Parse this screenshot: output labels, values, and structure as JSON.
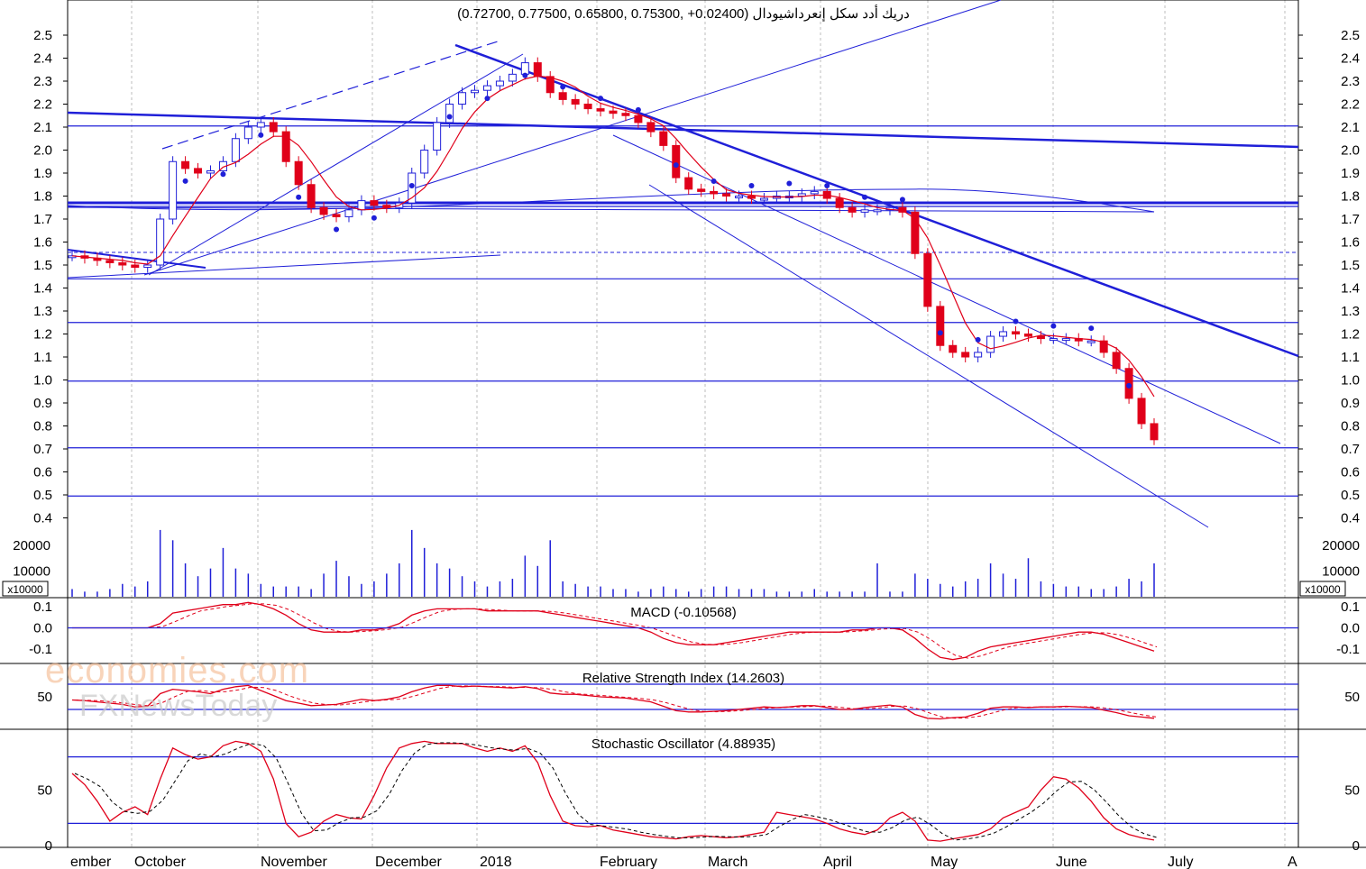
{
  "chart_data": {
    "type": "candlestick",
    "title": "(0.72700, 0.77500, 0.65800, 0.75300, +0.02400) دريك أدد سكل إنعرداشيودال",
    "x_labels": [
      "ember",
      "October",
      "November",
      "December",
      "2018",
      "February",
      "March",
      "April",
      "May",
      "June",
      "July",
      "A"
    ],
    "price_axis": {
      "ticks": [
        "0.4",
        "0.5",
        "0.6",
        "0.7",
        "0.8",
        "0.9",
        "1.0",
        "1.1",
        "1.2",
        "1.3",
        "1.4",
        "1.5",
        "1.6",
        "1.7",
        "1.8",
        "1.9",
        "2.0",
        "2.1",
        "2.2",
        "2.3",
        "2.4",
        "2.5"
      ],
      "ylim": [
        0.4,
        2.5
      ]
    },
    "price_series": [
      1.54,
      1.53,
      1.52,
      1.51,
      1.5,
      1.49,
      1.5,
      1.7,
      1.95,
      1.92,
      1.9,
      1.91,
      1.95,
      2.05,
      2.1,
      2.12,
      2.08,
      1.95,
      1.85,
      1.75,
      1.72,
      1.71,
      1.74,
      1.78,
      1.76,
      1.75,
      1.77,
      1.9,
      2.0,
      2.12,
      2.2,
      2.25,
      2.26,
      2.28,
      2.3,
      2.33,
      2.38,
      2.32,
      2.25,
      2.22,
      2.2,
      2.18,
      2.17,
      2.16,
      2.15,
      2.12,
      2.08,
      2.02,
      1.88,
      1.83,
      1.82,
      1.81,
      1.8,
      1.8,
      1.79,
      1.79,
      1.8,
      1.8,
      1.81,
      1.82,
      1.79,
      1.75,
      1.73,
      1.74,
      1.74,
      1.75,
      1.73,
      1.55,
      1.32,
      1.15,
      1.12,
      1.1,
      1.12,
      1.19,
      1.21,
      1.2,
      1.19,
      1.18,
      1.18,
      1.18,
      1.17,
      1.17,
      1.12,
      1.05,
      0.92,
      0.81,
      0.74
    ],
    "volume_axis": {
      "ticks": [
        "10000",
        "20000"
      ],
      "unit": "x10000"
    },
    "volume_series": [
      0.3,
      0.2,
      0.2,
      0.3,
      0.5,
      0.4,
      0.6,
      2.6,
      2.2,
      1.3,
      0.8,
      1.1,
      1.9,
      1.1,
      0.9,
      0.5,
      0.4,
      0.4,
      0.4,
      0.3,
      0.9,
      1.4,
      0.8,
      0.5,
      0.6,
      0.9,
      1.3,
      2.6,
      1.9,
      1.3,
      1.1,
      0.8,
      0.6,
      0.4,
      0.6,
      0.7,
      1.6,
      1.2,
      2.2,
      0.6,
      0.5,
      0.4,
      0.4,
      0.3,
      0.3,
      0.2,
      0.3,
      0.4,
      0.3,
      0.2,
      0.3,
      0.4,
      0.4,
      0.3,
      0.3,
      0.3,
      0.2,
      0.2,
      0.2,
      0.3,
      0.2,
      0.2,
      0.2,
      0.2,
      1.3,
      0.2,
      0.2,
      0.9,
      0.7,
      0.5,
      0.4,
      0.6,
      0.7,
      1.3,
      0.9,
      0.7,
      1.5,
      0.6,
      0.5,
      0.4,
      0.4,
      0.3,
      0.3,
      0.4,
      0.7,
      0.6,
      1.3
    ],
    "macd": {
      "label": "MACD (-0.10568)",
      "ticks": [
        "-0.1",
        "0.0",
        "0.1"
      ],
      "ylim": [
        -0.16,
        0.13
      ],
      "values": [
        0.0,
        0.0,
        0.0,
        0.0,
        0.0,
        0.0,
        0.0,
        0.02,
        0.07,
        0.08,
        0.09,
        0.1,
        0.11,
        0.11,
        0.12,
        0.11,
        0.09,
        0.06,
        0.02,
        -0.01,
        -0.02,
        -0.02,
        -0.02,
        -0.01,
        -0.01,
        0.0,
        0.02,
        0.06,
        0.08,
        0.09,
        0.09,
        0.09,
        0.09,
        0.08,
        0.08,
        0.08,
        0.08,
        0.08,
        0.07,
        0.06,
        0.05,
        0.04,
        0.03,
        0.02,
        0.01,
        0.0,
        -0.02,
        -0.05,
        -0.07,
        -0.08,
        -0.08,
        -0.08,
        -0.07,
        -0.06,
        -0.05,
        -0.04,
        -0.03,
        -0.02,
        -0.02,
        -0.02,
        -0.02,
        -0.02,
        -0.01,
        -0.01,
        0.0,
        0.0,
        -0.01,
        -0.05,
        -0.1,
        -0.14,
        -0.15,
        -0.14,
        -0.11,
        -0.09,
        -0.08,
        -0.07,
        -0.06,
        -0.05,
        -0.04,
        -0.03,
        -0.02,
        -0.02,
        -0.03,
        -0.05,
        -0.07,
        -0.09,
        -0.11
      ]
    },
    "rsi": {
      "label": "Relative Strength Index (14.2603)",
      "ticks": [
        "50"
      ],
      "ylim": [
        0,
        100
      ],
      "levels": [
        70,
        30
      ],
      "values": [
        45,
        44,
        42,
        40,
        38,
        34,
        35,
        55,
        62,
        60,
        58,
        55,
        62,
        66,
        68,
        60,
        52,
        44,
        40,
        36,
        37,
        38,
        42,
        46,
        44,
        46,
        50,
        58,
        64,
        68,
        68,
        66,
        67,
        66,
        65,
        64,
        66,
        63,
        56,
        54,
        54,
        52,
        50,
        49,
        48,
        45,
        42,
        35,
        28,
        26,
        26,
        27,
        28,
        30,
        32,
        34,
        33,
        34,
        36,
        36,
        33,
        30,
        30,
        33,
        35,
        37,
        34,
        22,
        16,
        15,
        17,
        18,
        24,
        32,
        34,
        34,
        33,
        34,
        34,
        35,
        34,
        33,
        29,
        25,
        20,
        18,
        16
      ]
    },
    "stochastic": {
      "label": "Stochastic Oscillator (4.88935)",
      "ticks": [
        "0",
        "50"
      ],
      "ylim": [
        0,
        100
      ],
      "levels": [
        80,
        20
      ],
      "values": [
        65,
        55,
        40,
        22,
        30,
        35,
        28,
        60,
        88,
        82,
        78,
        80,
        90,
        94,
        92,
        85,
        60,
        20,
        8,
        12,
        22,
        28,
        25,
        24,
        45,
        70,
        88,
        92,
        94,
        92,
        92,
        92,
        88,
        85,
        88,
        85,
        90,
        75,
        45,
        22,
        18,
        17,
        18,
        14,
        12,
        10,
        8,
        7,
        6,
        8,
        9,
        8,
        7,
        8,
        10,
        12,
        30,
        28,
        26,
        24,
        20,
        15,
        12,
        10,
        14,
        25,
        30,
        22,
        5,
        4,
        6,
        8,
        10,
        15,
        25,
        30,
        35,
        50,
        62,
        60,
        52,
        40,
        25,
        15,
        10,
        7,
        5
      ]
    }
  }
}
